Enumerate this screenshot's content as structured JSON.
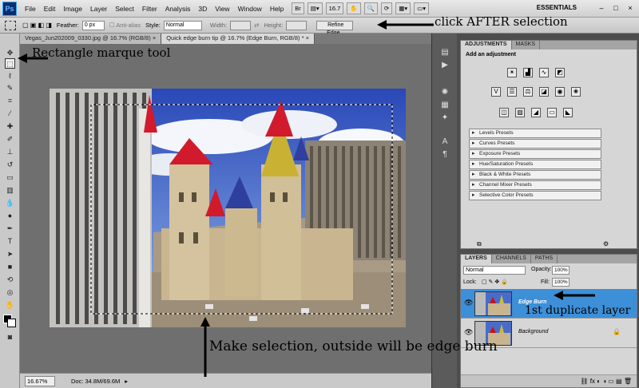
{
  "app": {
    "logo": "Ps"
  },
  "menu": [
    "File",
    "Edit",
    "Image",
    "Layer",
    "Select",
    "Filter",
    "Analysis",
    "3D",
    "View",
    "Window",
    "Help"
  ],
  "menubar_buttons": {
    "br": "Br",
    "zoom": "16.7",
    "workspace": "ESSENTIALS"
  },
  "window_controls": {
    "minimize": "–",
    "maximize": "□",
    "close": "×"
  },
  "options": {
    "feather_label": "Feather:",
    "feather_value": "0 px",
    "antialias_label": "Anti-alias",
    "style_label": "Style:",
    "style_value": "Normal",
    "width_label": "Width:",
    "height_label": "Height:",
    "refine_edge": "Refine Edge..."
  },
  "tabs": [
    {
      "title": "Vegas_Jun202009_0330.jpg @ 16.7% (RGB/8)",
      "close": "×"
    },
    {
      "title": "Quick edge burn tip @ 16.7% (Edge Burn, RGB/8) *",
      "close": "×"
    }
  ],
  "status": {
    "zoom": "16.67%",
    "doc": "Doc: 34.8M/69.6M"
  },
  "adjustments": {
    "tabs": [
      "ADJUSTMENTS",
      "MASKS"
    ],
    "title": "Add an adjustment",
    "presets": [
      "Levels Presets",
      "Curves Presets",
      "Exposure Presets",
      "Hue/Saturation Presets",
      "Black & White Presets",
      "Channel Mixer Presets",
      "Selective Color Presets"
    ]
  },
  "layers": {
    "tabs": [
      "LAYERS",
      "CHANNELS",
      "PATHS"
    ],
    "blend_mode": "Normal",
    "opacity_label": "Opacity:",
    "opacity_value": "100%",
    "lock_label": "Lock:",
    "fill_label": "Fill:",
    "fill_value": "100%",
    "items": [
      {
        "name": "Edge Burn",
        "selected": true
      },
      {
        "name": "Background",
        "selected": false
      }
    ]
  },
  "annotations": {
    "click_after": "click AFTER selection",
    "marquee": "Rectangle marque tool",
    "make_selection": "Make selection, outside will be edge burn",
    "duplicate": "1st duplicate layer"
  },
  "colors": {
    "accent": "#3d8fd8",
    "selected_layer": "#3d8fd8",
    "sky": "#3a5dbf"
  }
}
